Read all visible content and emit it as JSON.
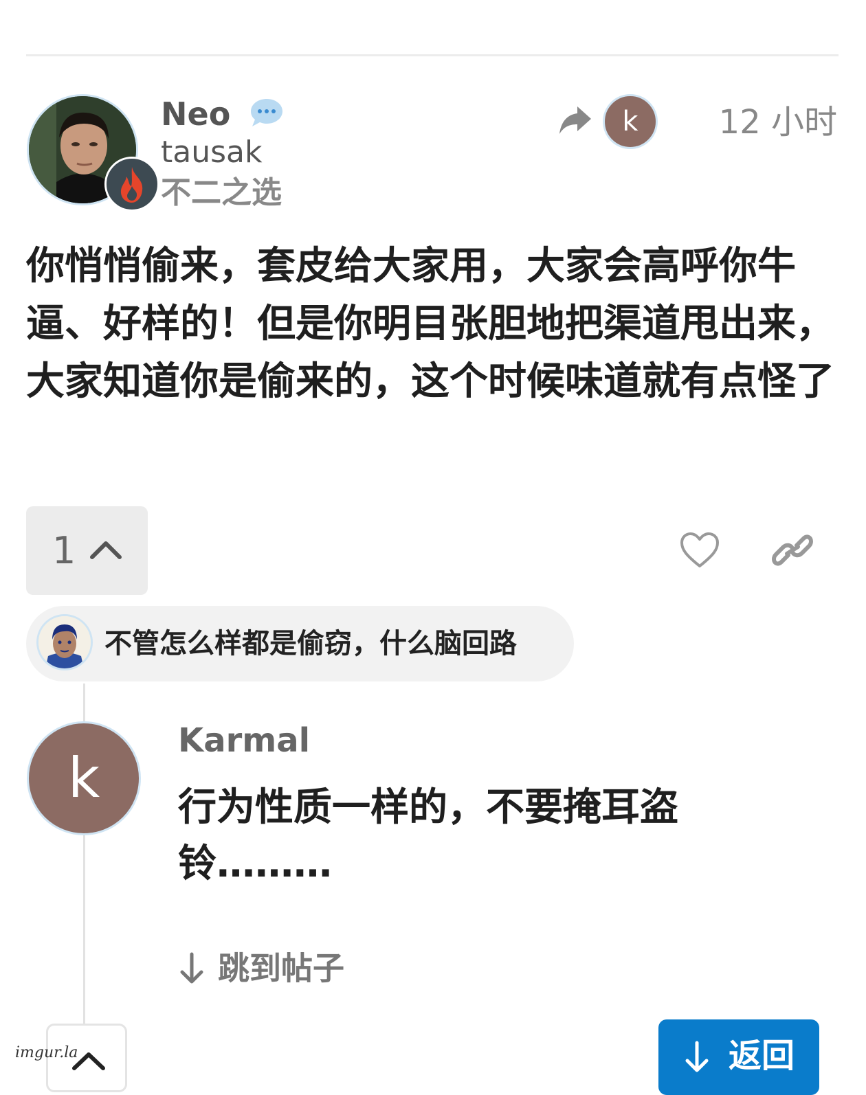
{
  "post": {
    "author": {
      "username": "Neo",
      "handle": "tausak",
      "title": "不二之选",
      "avatar_icon": "neo-avatar",
      "flair_icon": "flame-icon",
      "chat_icon": "chat-bubble-icon"
    },
    "reply_to": {
      "icon": "reply-arrow-icon",
      "avatar_letter": "k"
    },
    "time": "12 小时",
    "body": "你悄悄偷来，套皮给大家用，大家会高呼你牛逼、好样的！但是你明目张胆地把渠道甩出来，大家知道你是偷来的，这个时候味道就有点怪了",
    "vote_count": "1",
    "actions": {
      "like_icon": "heart-icon",
      "link_icon": "link-icon",
      "vote_icon": "chevron-up-icon"
    }
  },
  "quoted_reply": {
    "text": "不管怎么样都是偷窃，什么脑回路",
    "avatar_icon": "cartoon-face-avatar"
  },
  "reply": {
    "avatar_letter": "k",
    "username": "Karmal",
    "body": "行为性质一样的，不要掩耳盗铃………"
  },
  "jump_to_post": "跳到帖子",
  "back_button": "返回",
  "watermark": "imgur.la",
  "colors": {
    "accent": "#0a7ccb",
    "avatar_k": "#8c6b63",
    "flair_bg": "#3d4a52",
    "flame": "#e5452b"
  }
}
